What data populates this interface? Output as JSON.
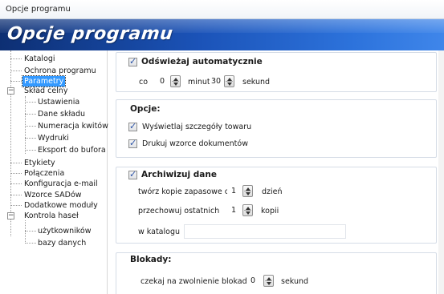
{
  "window": {
    "title": "Opcje programu"
  },
  "banner": {
    "title": "Opcje programu"
  },
  "tree": {
    "items": [
      "Katalogi",
      "Ochrona programu",
      "Parametry",
      "Skład celny",
      "Ustawienia",
      "Dane składu",
      "Numeracja kwitów",
      "Wydruki",
      "Eksport do bufora",
      "Etykiety",
      "Połączenia",
      "Konfiguracja e-mail",
      "Wzorce SADów",
      "Dodatkowe moduły",
      "Kontrola haseł",
      "użytkowników",
      "bazy danych"
    ],
    "expander_symbol": "−"
  },
  "refresh": {
    "checkbox_label": "Odświeżaj automatycznie",
    "every_label": "co",
    "minutes_value": "0",
    "minutes_label": "minut",
    "seconds_value": "30",
    "seconds_label": "sekund"
  },
  "options": {
    "header": "Opcje:",
    "show_details_label": "Wyświetlaj szczegóły towaru",
    "print_templates_label": "Drukuj wzorce dokumentów"
  },
  "archive": {
    "checkbox_label": "Archiwizuj dane",
    "backup_label": "twórz kopie zapasowe co",
    "backup_value": "1",
    "backup_unit": "dzień",
    "keep_label": "przechowuj ostatnich",
    "keep_value": "1",
    "keep_unit": "kopii",
    "folder_label": "w katalogu",
    "folder_value": ""
  },
  "locks": {
    "header": "Blokady:",
    "wait_label": "czekaj na zwolnienie blokady",
    "wait_value": "0",
    "wait_unit": "sekund"
  },
  "colors": {
    "banner": "#1b53b8",
    "selection": "#3399ff"
  }
}
